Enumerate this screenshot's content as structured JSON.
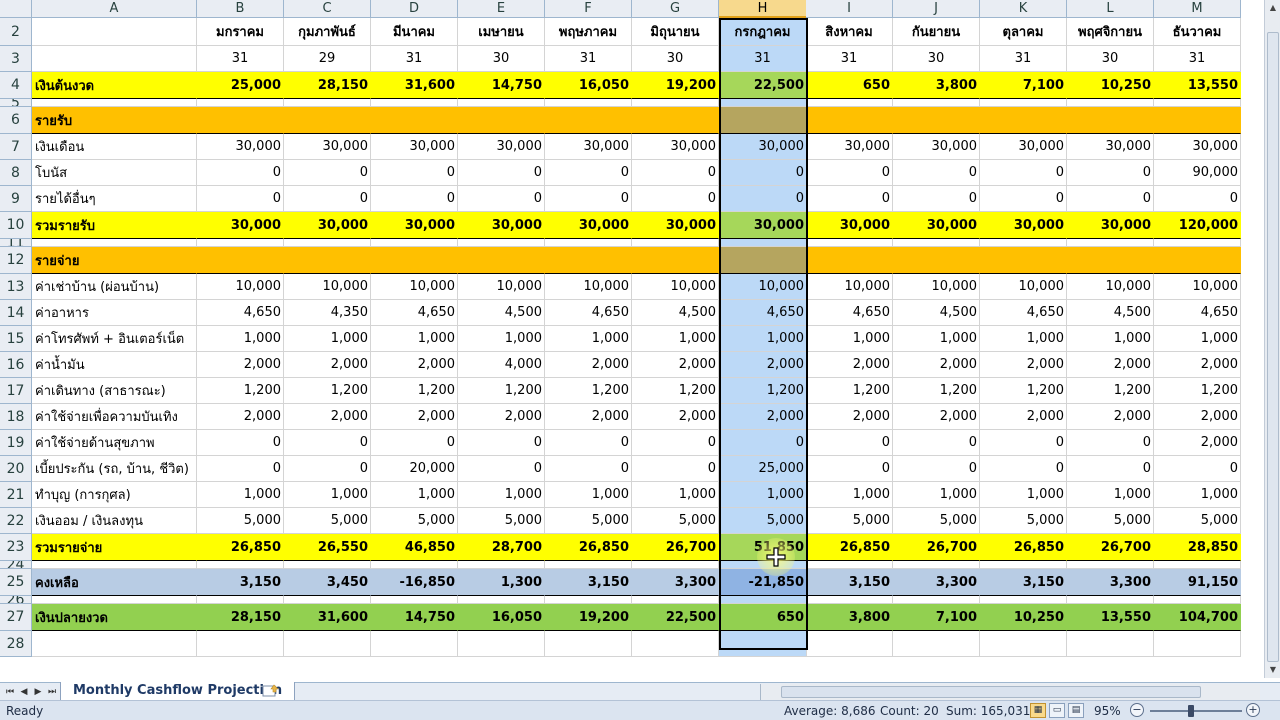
{
  "columns": [
    "A",
    "B",
    "C",
    "D",
    "E",
    "F",
    "G",
    "H",
    "I",
    "J",
    "K",
    "L",
    "M"
  ],
  "selected_column": "H",
  "months": [
    "มกราคม",
    "กุมภาพันธ์",
    "มีนาคม",
    "เมษายน",
    "พฤษภาคม",
    "มิถุนายน",
    "กรกฎาคม",
    "สิงหาคม",
    "กันยายน",
    "ตุลาคม",
    "พฤศจิกายน",
    "ธันวาคม"
  ],
  "days": [
    "31",
    "29",
    "31",
    "30",
    "31",
    "30",
    "31",
    "31",
    "30",
    "31",
    "30",
    "31"
  ],
  "rows": [
    {
      "num": "2",
      "kind": "month"
    },
    {
      "num": "3",
      "kind": "days"
    },
    {
      "num": "4",
      "kind": "data",
      "style": "yellow",
      "bold": true,
      "label": "เงินต้นงวด",
      "values": [
        "25,000",
        "28,150",
        "31,600",
        "14,750",
        "16,050",
        "19,200",
        "22,500",
        "650",
        "3,800",
        "7,100",
        "10,250",
        "13,550"
      ]
    },
    {
      "num": "5",
      "kind": "spacer"
    },
    {
      "num": "6",
      "kind": "data",
      "style": "orange",
      "bold": true,
      "label": "รายรับ",
      "values": [
        "",
        "",
        "",
        "",
        "",
        "",
        "",
        "",
        "",
        "",
        "",
        ""
      ]
    },
    {
      "num": "7",
      "kind": "data",
      "label": "เงินเดือน",
      "values": [
        "30,000",
        "30,000",
        "30,000",
        "30,000",
        "30,000",
        "30,000",
        "30,000",
        "30,000",
        "30,000",
        "30,000",
        "30,000",
        "30,000"
      ]
    },
    {
      "num": "8",
      "kind": "data",
      "label": "โบนัส",
      "values": [
        "0",
        "0",
        "0",
        "0",
        "0",
        "0",
        "0",
        "0",
        "0",
        "0",
        "0",
        "90,000"
      ]
    },
    {
      "num": "9",
      "kind": "data",
      "label": "รายได้อื่นๆ",
      "values": [
        "0",
        "0",
        "0",
        "0",
        "0",
        "0",
        "0",
        "0",
        "0",
        "0",
        "0",
        "0"
      ]
    },
    {
      "num": "10",
      "kind": "data",
      "style": "yellow",
      "bold": true,
      "label": "รวมรายรับ",
      "values": [
        "30,000",
        "30,000",
        "30,000",
        "30,000",
        "30,000",
        "30,000",
        "30,000",
        "30,000",
        "30,000",
        "30,000",
        "30,000",
        "120,000"
      ]
    },
    {
      "num": "11",
      "kind": "spacer"
    },
    {
      "num": "12",
      "kind": "data",
      "style": "orange",
      "bold": true,
      "label": "รายจ่าย",
      "values": [
        "",
        "",
        "",
        "",
        "",
        "",
        "",
        "",
        "",
        "",
        "",
        ""
      ]
    },
    {
      "num": "13",
      "kind": "data",
      "label": "ค่าเช่าบ้าน (ผ่อนบ้าน)",
      "values": [
        "10,000",
        "10,000",
        "10,000",
        "10,000",
        "10,000",
        "10,000",
        "10,000",
        "10,000",
        "10,000",
        "10,000",
        "10,000",
        "10,000"
      ]
    },
    {
      "num": "14",
      "kind": "data",
      "label": "ค่าอาหาร",
      "values": [
        "4,650",
        "4,350",
        "4,650",
        "4,500",
        "4,650",
        "4,500",
        "4,650",
        "4,650",
        "4,500",
        "4,650",
        "4,500",
        "4,650"
      ]
    },
    {
      "num": "15",
      "kind": "data",
      "label": "ค่าโทรศัพท์ + อินเตอร์เน็ต",
      "values": [
        "1,000",
        "1,000",
        "1,000",
        "1,000",
        "1,000",
        "1,000",
        "1,000",
        "1,000",
        "1,000",
        "1,000",
        "1,000",
        "1,000"
      ]
    },
    {
      "num": "16",
      "kind": "data",
      "label": "ค่าน้ำมัน",
      "values": [
        "2,000",
        "2,000",
        "2,000",
        "4,000",
        "2,000",
        "2,000",
        "2,000",
        "2,000",
        "2,000",
        "2,000",
        "2,000",
        "2,000"
      ]
    },
    {
      "num": "17",
      "kind": "data",
      "label": "ค่าเดินทาง (สาธารณะ)",
      "values": [
        "1,200",
        "1,200",
        "1,200",
        "1,200",
        "1,200",
        "1,200",
        "1,200",
        "1,200",
        "1,200",
        "1,200",
        "1,200",
        "1,200"
      ]
    },
    {
      "num": "18",
      "kind": "data",
      "label": "ค่าใช้จ่ายเพื่อความบันเทิง",
      "values": [
        "2,000",
        "2,000",
        "2,000",
        "2,000",
        "2,000",
        "2,000",
        "2,000",
        "2,000",
        "2,000",
        "2,000",
        "2,000",
        "2,000"
      ]
    },
    {
      "num": "19",
      "kind": "data",
      "label": "ค่าใช้จ่ายด้านสุขภาพ",
      "values": [
        "0",
        "0",
        "0",
        "0",
        "0",
        "0",
        "0",
        "0",
        "0",
        "0",
        "0",
        "2,000"
      ]
    },
    {
      "num": "20",
      "kind": "data",
      "label": "เบี้ยประกัน (รถ, บ้าน, ชีวิต)",
      "values": [
        "0",
        "0",
        "20,000",
        "0",
        "0",
        "0",
        "25,000",
        "0",
        "0",
        "0",
        "0",
        "0"
      ]
    },
    {
      "num": "21",
      "kind": "data",
      "label": "ทำบุญ (การกุศล)",
      "values": [
        "1,000",
        "1,000",
        "1,000",
        "1,000",
        "1,000",
        "1,000",
        "1,000",
        "1,000",
        "1,000",
        "1,000",
        "1,000",
        "1,000"
      ]
    },
    {
      "num": "22",
      "kind": "data",
      "label": "เงินออม / เงินลงทุน",
      "values": [
        "5,000",
        "5,000",
        "5,000",
        "5,000",
        "5,000",
        "5,000",
        "5,000",
        "5,000",
        "5,000",
        "5,000",
        "5,000",
        "5,000"
      ]
    },
    {
      "num": "23",
      "kind": "data",
      "style": "yellow",
      "bold": true,
      "label": "รวมรายจ่าย",
      "values": [
        "26,850",
        "26,550",
        "46,850",
        "28,700",
        "26,850",
        "26,700",
        "51,850",
        "26,850",
        "26,700",
        "26,850",
        "26,700",
        "28,850"
      ]
    },
    {
      "num": "24",
      "kind": "spacer"
    },
    {
      "num": "25",
      "kind": "data",
      "style": "blue",
      "bold": true,
      "label": "คงเหลือ",
      "values": [
        "3,150",
        "3,450",
        "-16,850",
        "1,300",
        "3,150",
        "3,300",
        "-21,850",
        "3,150",
        "3,300",
        "3,150",
        "3,300",
        "91,150"
      ]
    },
    {
      "num": "26",
      "kind": "spacer"
    },
    {
      "num": "27",
      "kind": "data",
      "style": "green",
      "bold": true,
      "label": "เงินปลายงวด",
      "values": [
        "28,150",
        "31,600",
        "14,750",
        "16,050",
        "19,200",
        "22,500",
        "650",
        "3,800",
        "7,100",
        "10,250",
        "13,550",
        "104,700"
      ]
    },
    {
      "num": "28",
      "kind": "blank"
    }
  ],
  "sheet_tab": "Monthly Cashflow Projection",
  "status": {
    "ready": "Ready",
    "average": "Average: 8,686",
    "count": "Count: 20",
    "sum": "Sum: 165,031",
    "zoom": "95%"
  },
  "colors": {
    "yellow": "#ffff00",
    "orange": "#ffc000",
    "blue": "#b8cce4",
    "green": "#92d050",
    "selection": "#bcd9f7"
  },
  "icons": {
    "insert_sheet": "insert-sheet-icon",
    "cursor": "move-cursor-icon"
  }
}
